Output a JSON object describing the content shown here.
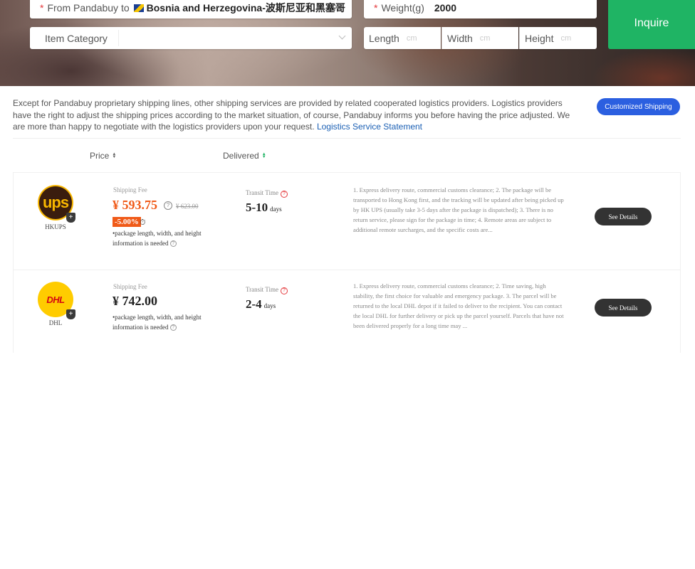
{
  "search": {
    "route_prefix": "From Pandabuy to",
    "destination": "Bosnia and Herzegovina-波斯尼亚和黑塞哥",
    "clear": "×",
    "weight_label": "Weight(g)",
    "weight_value": "2000",
    "category_placeholder": "Item Category",
    "length_label": "Length",
    "width_label": "Width",
    "height_label": "Height",
    "unit": "cm",
    "required_mark": "*",
    "inquire_label": "Inquire"
  },
  "notice": {
    "text": "Except for Pandabuy proprietary shipping lines, other shipping services are provided by related cooperated logistics providers. Logistics providers have the right to adjust the shipping prices according to the market situation, of course, Pandabuy informs you before having the price adjusted. We are more than happy to negotiate with the logistics providers upon your request.",
    "link": "Logistics Service Statement",
    "custom_button": "Customized Shipping"
  },
  "sort": {
    "price": "Price",
    "delivered": "Delivered"
  },
  "colors": {
    "accent_green": "#1fb464",
    "price_orange": "#f05a18",
    "button_blue": "#2b5fe0"
  },
  "results": [
    {
      "carrier": "HKUPS",
      "logo_text": "ups",
      "fee_label": "Shipping Fee",
      "price": "¥ 593.75",
      "original_price": "¥ 623.00",
      "discount": "-5.00%",
      "note": "•package length, width, and height information is needed",
      "transit_label": "Transit Time",
      "transit_value": "5-10",
      "transit_unit": "days",
      "description": "1. Express delivery route, commercial customs clearance; 2. The package will be transported to Hong Kong first, and the tracking will be updated after being picked up by HK UPS (usually take 3-5 days after the package is dispatched); 3. There is no return service, please sign for the package in time; 4. Remote areas are subject to additional remote surcharges, and the specific costs are...",
      "details": "See Details"
    },
    {
      "carrier": "DHL",
      "logo_text": "DHL",
      "fee_label": "Shipping Fee",
      "price": "¥ 742.00",
      "note": "•package length, width, and height information is needed",
      "transit_label": "Transit Time",
      "transit_value": "2-4",
      "transit_unit": "days",
      "description": "1. Express delivery route, commercial customs clearance; 2. Time saving, high stability, the first choice for valuable and emergency package. 3. The parcel will be returned to the local DHL depot if it failed to deliver to the recipient. You can contact the local DHL for further delivery or pick up the parcel yourself. Parcels that have not been delivered properly for a long time may ...",
      "details": "See Details"
    }
  ]
}
